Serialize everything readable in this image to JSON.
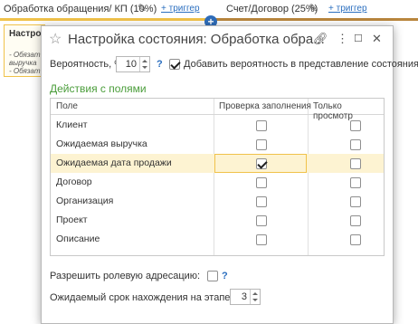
{
  "board": {
    "col1_title": "Обработка обращения/ КП (10%)",
    "col2_title": "Счет/Договор (25%)",
    "trigger_label": "+ триггер",
    "plus": "+",
    "card_title": "Настро",
    "card_lines": [
      "- Обязат",
      "выручка",
      "- Обязат"
    ]
  },
  "dialog": {
    "title": "Настройка состояния: Обработка обра...",
    "probability_label": "Вероятность, %:",
    "probability_value": "10",
    "add_probability_label": "Добавить вероятность в представление состояния",
    "add_probability_checked": true,
    "section_title": "Действия с полями",
    "columns": [
      "Поле",
      "Проверка заполнения",
      "Только просмотр"
    ],
    "rows": [
      {
        "field": "Клиент",
        "check": false,
        "readonly": false
      },
      {
        "field": "Ожидаемая выручка",
        "check": false,
        "readonly": false
      },
      {
        "field": "Ожидаемая дата продажи",
        "check": true,
        "readonly": false
      },
      {
        "field": "Договор",
        "check": false,
        "readonly": false
      },
      {
        "field": "Организация",
        "check": false,
        "readonly": false
      },
      {
        "field": "Проект",
        "check": false,
        "readonly": false
      },
      {
        "field": "Описание",
        "check": false,
        "readonly": false
      }
    ],
    "role_addressing_label": "Разрешить ролевую адресацию:",
    "stage_duration_label": "Ожидаемый срок нахождения на этапе:",
    "stage_duration_value": "3",
    "help_glyph": "?"
  },
  "icons": {
    "star": "star-icon",
    "link": "link-icon",
    "menu": "more-vertical-icon",
    "maximize": "maximize-icon",
    "close": "close-icon",
    "edit": "pencil-icon"
  },
  "colors": {
    "accent_green": "#4a9d3a",
    "selection": "#fdf3d2",
    "stage_band_1": "#f0c24a",
    "stage_band_2": "#b9863d",
    "link_blue": "#2a6ebf"
  }
}
